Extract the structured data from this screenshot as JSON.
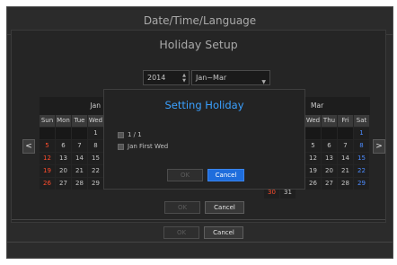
{
  "outer": {
    "title": "Date/Time/Language"
  },
  "holiday_setup": {
    "title": "Holiday Setup",
    "year": "2014",
    "range": "Jan~Mar",
    "ok_label": "OK",
    "cancel_label": "Cancel"
  },
  "calendar_left": {
    "month": "Jan",
    "weekdays": [
      "Sun",
      "Mon",
      "Tue",
      "Wed"
    ],
    "rows": [
      [
        "",
        "",
        "",
        "1"
      ],
      [
        "5",
        "6",
        "7",
        "8"
      ],
      [
        "12",
        "13",
        "14",
        "15"
      ],
      [
        "19",
        "20",
        "21",
        "22"
      ],
      [
        "26",
        "27",
        "28",
        "29"
      ]
    ]
  },
  "calendar_right": {
    "month": "Mar",
    "weekdays": [
      "Wed",
      "Thu",
      "Fri",
      "Sat"
    ],
    "rows": [
      [
        "",
        "",
        "",
        "1"
      ],
      [
        "5",
        "6",
        "7",
        "8"
      ],
      [
        "12",
        "13",
        "14",
        "15"
      ],
      [
        "19",
        "20",
        "21",
        "22"
      ],
      [
        "26",
        "27",
        "28",
        "29"
      ]
    ],
    "extra_row": [
      "30",
      "31"
    ]
  },
  "modal": {
    "title": "Setting Holiday",
    "options": [
      "1 / 1",
      "Jan First Wed"
    ],
    "ok_label": "OK",
    "cancel_label": "Cancel"
  },
  "bottom": {
    "ok_label": "OK",
    "cancel_label": "Cancel"
  },
  "nav": {
    "prev": "<",
    "next": ">"
  },
  "colors": {
    "accent": "#1e6ddc",
    "sunday": "#ff4c2c",
    "saturday": "#4d8cff",
    "title_blue": "#3aa0ff"
  }
}
